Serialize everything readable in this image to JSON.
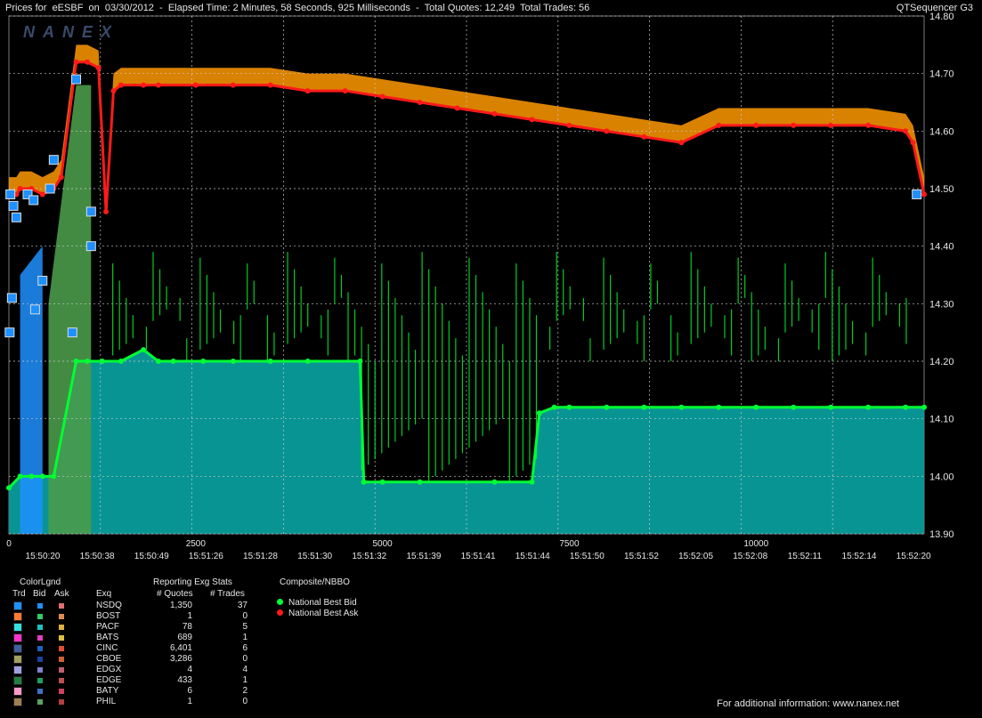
{
  "header": {
    "title": "Prices for  eESBF  on  03/30/2012  -  Elapsed Time: 2 Minutes, 58 Seconds, 925 Milliseconds  -  Total Quotes: 12,249  Total Trades: 56",
    "app_name": "QTSequencer G3",
    "watermark": "NANEX"
  },
  "colors": {
    "bid": "#00ff33",
    "ask": "#ff1a1a",
    "bid_fill": "#0a9c9c",
    "ask_fill": "#ff9900",
    "nsdq": "#1e90ff",
    "grid": "#c8c8c8"
  },
  "chart_data": {
    "type": "line",
    "ylim": [
      13.9,
      14.8
    ],
    "yticks": [
      "14.80",
      "14.70",
      "14.60",
      "14.50",
      "14.40",
      "14.30",
      "14.20",
      "14.10",
      "14.00",
      "13.90"
    ],
    "x_quote_ticks": [
      "0",
      "2500",
      "5000",
      "7500",
      "10000"
    ],
    "x_time_labels": [
      "15:50:20",
      "15:50:38",
      "15:50:49",
      "15:51:26",
      "15:51:28",
      "15:51:30",
      "15:51:32",
      "15:51:39",
      "15:51:41",
      "15:51:44",
      "15:51:50",
      "15:51:52",
      "15:52:05",
      "15:52:08",
      "15:52:11",
      "15:52:14",
      "15:52:20"
    ],
    "grid": true,
    "series": [
      {
        "name": "National Best Bid",
        "x": [
          0,
          150,
          300,
          450,
          600,
          900,
          1050,
          1250,
          1500,
          1800,
          2000,
          2200,
          2600,
          3000,
          3500,
          4000,
          4700,
          4750,
          5000,
          5500,
          6500,
          7000,
          7100,
          7300,
          7500,
          8000,
          8500,
          9000,
          9500,
          10000,
          10500,
          11000,
          11500,
          12000,
          12249
        ],
        "y": [
          13.98,
          14.0,
          14.0,
          14.0,
          14.0,
          14.2,
          14.2,
          14.2,
          14.2,
          14.22,
          14.2,
          14.2,
          14.2,
          14.2,
          14.2,
          14.2,
          14.2,
          13.99,
          13.99,
          13.99,
          13.99,
          13.99,
          14.11,
          14.12,
          14.12,
          14.12,
          14.12,
          14.12,
          14.12,
          14.12,
          14.12,
          14.12,
          14.12,
          14.12,
          14.12
        ]
      },
      {
        "name": "National Best Ask",
        "x": [
          0,
          100,
          150,
          300,
          450,
          600,
          700,
          900,
          1050,
          1200,
          1300,
          1400,
          1500,
          1800,
          2000,
          2500,
          3000,
          3500,
          4000,
          4500,
          5000,
          5500,
          6000,
          6500,
          7000,
          7500,
          8000,
          8500,
          9000,
          9500,
          10000,
          10500,
          11000,
          11500,
          12000,
          12100,
          12249
        ],
        "y": [
          14.49,
          14.49,
          14.5,
          14.5,
          14.49,
          14.5,
          14.52,
          14.72,
          14.72,
          14.71,
          14.46,
          14.67,
          14.68,
          14.68,
          14.68,
          14.68,
          14.68,
          14.68,
          14.67,
          14.67,
          14.66,
          14.65,
          14.64,
          14.63,
          14.62,
          14.61,
          14.6,
          14.59,
          14.58,
          14.61,
          14.61,
          14.61,
          14.61,
          14.61,
          14.6,
          14.58,
          14.49
        ]
      }
    ]
  },
  "legend": {
    "color_legend_title": "ColorLgnd",
    "col_trd": "Trd",
    "col_bid": "Bid",
    "col_ask": "Ask",
    "col_exq": "Exq",
    "stats_title": "Reporting Exg Stats",
    "col_quotes": "# Quotes",
    "col_trades": "# Trades",
    "composite_title": "Composite/NBBO",
    "nbbo_bid": "National Best Bid",
    "nbbo_ask": "National Best Ask",
    "rows": [
      {
        "ex": "NSDQ",
        "quotes": "1,350",
        "trades": "37",
        "trd": "#1e90ff",
        "bid": "#1e90ff",
        "ask": "#e07070"
      },
      {
        "ex": "BOST",
        "quotes": "1",
        "trades": "0",
        "trd": "#ff7a33",
        "bid": "#33cc66",
        "ask": "#e08a50"
      },
      {
        "ex": "PACF",
        "quotes": "78",
        "trades": "5",
        "trd": "#33e0e0",
        "bid": "#20c0c0",
        "ask": "#e0b040"
      },
      {
        "ex": "BATS",
        "quotes": "689",
        "trades": "1",
        "trd": "#ff33cc",
        "bid": "#e040c0",
        "ask": "#e0c040"
      },
      {
        "ex": "CINC",
        "quotes": "6,401",
        "trades": "6",
        "trd": "#4060a0",
        "bid": "#2060c0",
        "ask": "#e05030"
      },
      {
        "ex": "CBOE",
        "quotes": "3,286",
        "trades": "0",
        "trd": "#a0a060",
        "bid": "#2040a0",
        "ask": "#d06030"
      },
      {
        "ex": "EDGX",
        "quotes": "4",
        "trades": "4",
        "trd": "#a0a0e0",
        "bid": "#8080d0",
        "ask": "#c06070"
      },
      {
        "ex": "EDGE",
        "quotes": "433",
        "trades": "1",
        "trd": "#208040",
        "bid": "#20a060",
        "ask": "#c05050"
      },
      {
        "ex": "BATY",
        "quotes": "6",
        "trades": "2",
        "trd": "#ff99cc",
        "bid": "#4070c0",
        "ask": "#d04060"
      },
      {
        "ex": "PHIL",
        "quotes": "1",
        "trades": "0",
        "trd": "#a08050",
        "bid": "#60a060",
        "ask": "#b04040"
      }
    ]
  },
  "footer": "For additional information: www.nanex.net"
}
